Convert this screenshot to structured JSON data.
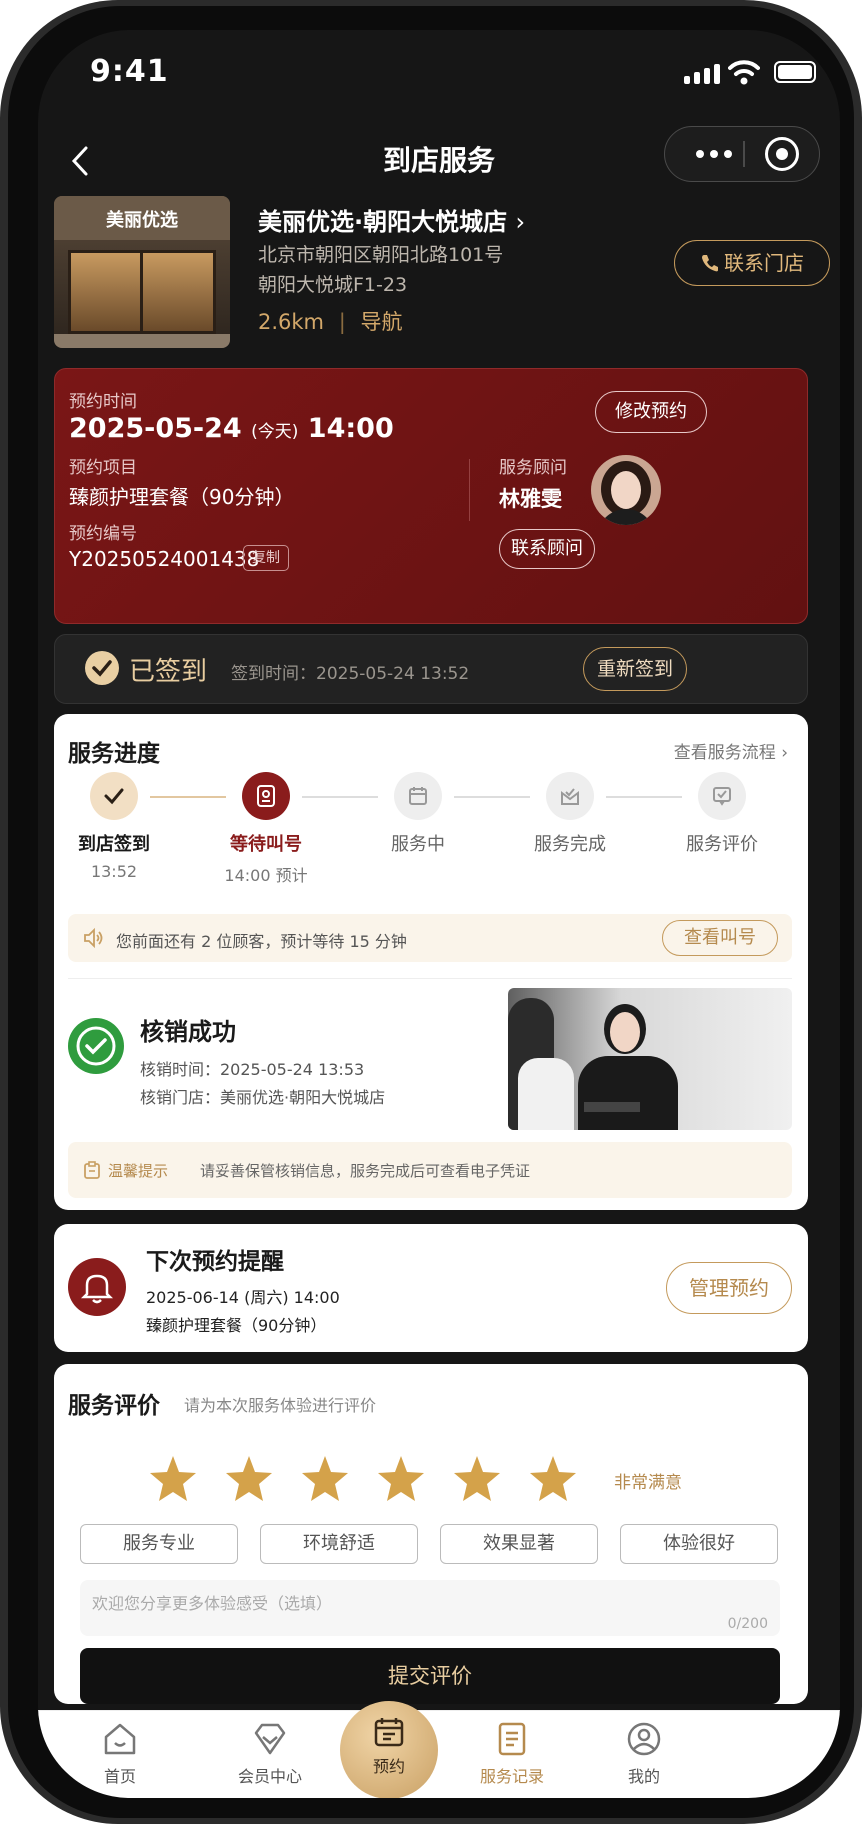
{
  "status_bar": {
    "time": "9:41"
  },
  "nav": {
    "title": "到店服务"
  },
  "store": {
    "sign": "美丽优选",
    "name": "美丽优选·朝阳大悦城店",
    "address_line1": "北京市朝阳区朝阳北路101号",
    "address_line2": "朝阳大悦城F1-23",
    "distance": "2.6km",
    "navigate": "导航",
    "contact_button": "联系门店"
  },
  "appointment": {
    "time_label": "预约时间",
    "date": "2025-05-24",
    "today": "(今天)",
    "time": "14:00",
    "modify_button": "修改预约",
    "project_label": "预约项目",
    "project": "臻颜护理套餐（90分钟）",
    "number_label": "预约编号",
    "number": "Y20250524001438",
    "copy": "复制",
    "advisor_label": "服务顾问",
    "advisor_name": "林雅雯",
    "contact_advisor_button": "联系顾问"
  },
  "checkin": {
    "status": "已签到",
    "time_text": "签到时间：2025-05-24 13:52",
    "recheck_button": "重新签到"
  },
  "progress": {
    "title": "服务进度",
    "link": "查看服务流程",
    "steps": [
      {
        "name": "到店签到",
        "sub": "13:52"
      },
      {
        "name": "等待叫号",
        "sub": "14:00 预计"
      },
      {
        "name": "服务中",
        "sub": ""
      },
      {
        "name": "服务完成",
        "sub": ""
      },
      {
        "name": "服务评价",
        "sub": ""
      }
    ],
    "queue_text": "您前面还有 2 位顾客，预计等待 15 分钟",
    "queue_button": "查看叫号",
    "verify_title": "核销成功",
    "verify_time": "核销时间：2025-05-24 13:53",
    "verify_store": "核销门店：美丽优选·朝阳大悦城店",
    "tip_label": "温馨提示",
    "tip_text": "请妥善保管核销信息，服务完成后可查看电子凭证"
  },
  "next": {
    "title": "下次预约提醒",
    "date": "2025-06-14 (周六) 14:00",
    "project": "臻颜护理套餐（90分钟）",
    "manage_button": "管理预约"
  },
  "review": {
    "title": "服务评价",
    "subtitle": "请为本次服务体验进行评价",
    "rating": 6,
    "rating_text": "非常满意",
    "tags": [
      "服务专业",
      "环境舒适",
      "效果显著",
      "体验很好"
    ],
    "placeholder": "欢迎您分享更多体验感受（选填）",
    "counter": "0/200",
    "submit": "提交评价"
  },
  "tabbar": {
    "home": "首页",
    "member": "会员中心",
    "book": "预约",
    "records": "服务记录",
    "mine": "我的"
  },
  "colors": {
    "accent_red": "#7a1616",
    "accent_gold": "#c9a064",
    "dark_bg": "#161616"
  }
}
